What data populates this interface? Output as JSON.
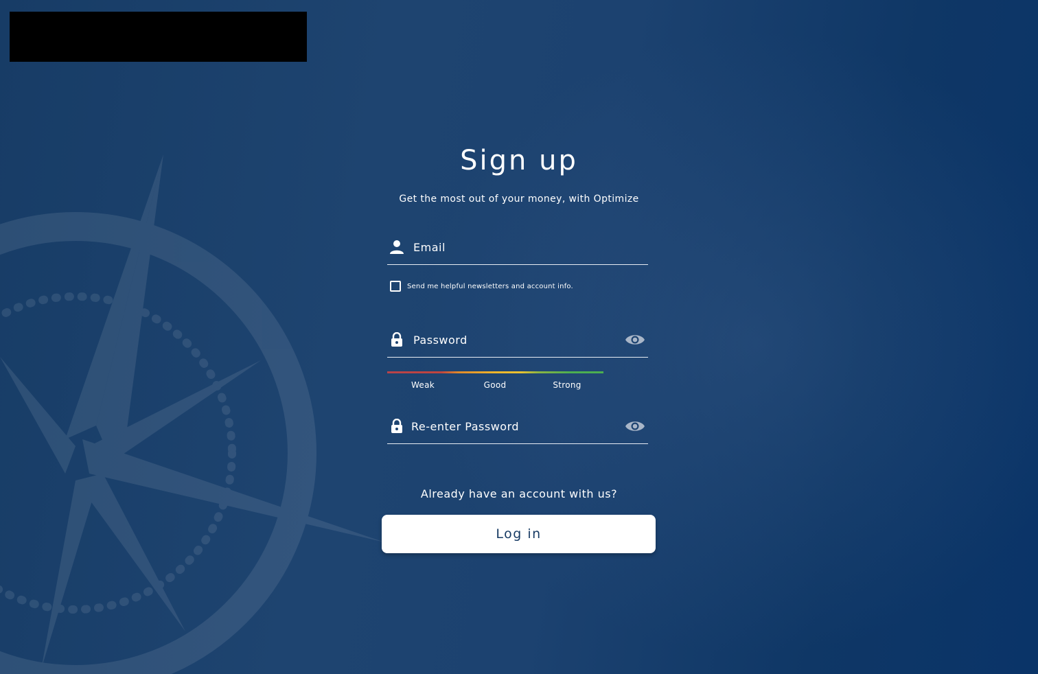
{
  "header": {
    "logo_redacted": true
  },
  "form": {
    "title": "Sign up",
    "subtitle": "Get the most out of your money, with Optimize",
    "email": {
      "placeholder": "Email",
      "value": "",
      "icon": "person-icon"
    },
    "newsletter": {
      "label": "Send me helpful newsletters and account info.",
      "checked": false
    },
    "password": {
      "placeholder": "Password",
      "value": "",
      "icon": "lock-icon",
      "toggle_icon": "eye-icon"
    },
    "strength": {
      "labels": [
        "Weak",
        "Good",
        "Strong"
      ],
      "colors": [
        "#c0453e",
        "#f0b62a",
        "#4caf50"
      ]
    },
    "confirm_password": {
      "placeholder": "Re-enter Password",
      "value": "",
      "icon": "lock-icon",
      "toggle_icon": "eye-icon"
    },
    "already_text": "Already have an account with us?",
    "login_label": "Log in"
  },
  "colors": {
    "background": "#1c4270",
    "button_text": "#163a63",
    "eye_icon": "#a9b6c8"
  }
}
